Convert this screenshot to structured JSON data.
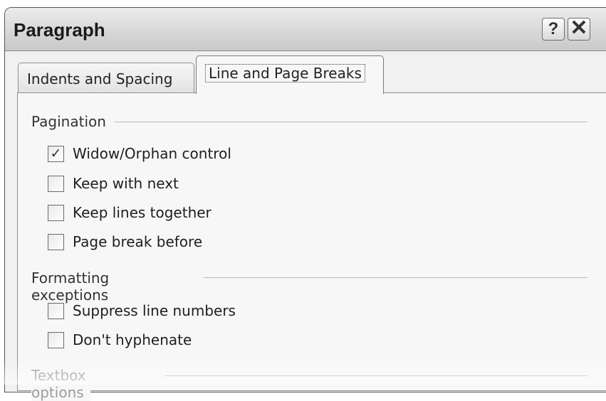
{
  "window": {
    "title": "Paragraph",
    "help_label": "?",
    "close_label": "✕",
    "help_icon": "help-icon",
    "close_icon": "close-icon"
  },
  "tabs": [
    {
      "label": "Indents and Spacing",
      "active": false
    },
    {
      "label": "Line and Page Breaks",
      "active": true
    }
  ],
  "pagination": {
    "label": "Pagination",
    "options": [
      {
        "label": "Widow/Orphan control",
        "checked": true
      },
      {
        "label": "Keep with next",
        "checked": false
      },
      {
        "label": "Keep lines together",
        "checked": false
      },
      {
        "label": "Page break before",
        "checked": false
      }
    ]
  },
  "formatting_exceptions": {
    "label": "Formatting exceptions",
    "options": [
      {
        "label": "Suppress line numbers",
        "checked": false
      },
      {
        "label": "Don't hyphenate",
        "checked": false
      }
    ]
  },
  "textbox_options": {
    "label": "Textbox options"
  },
  "check_mark": "✓"
}
